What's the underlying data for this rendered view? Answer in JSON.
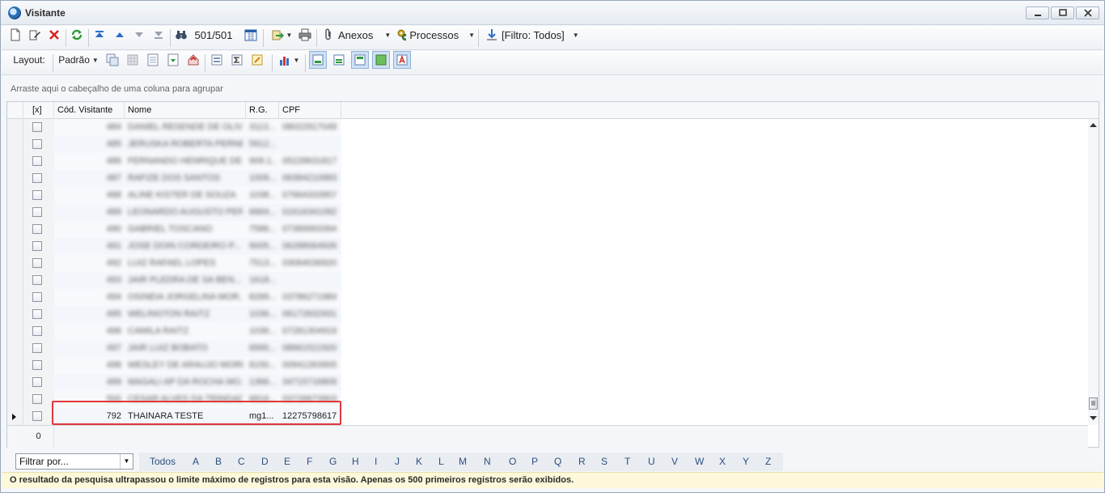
{
  "window": {
    "title": "Visitante"
  },
  "toolbar": {
    "record_counter": "501/501",
    "anexos_label": "Anexos",
    "processos_label": "Processos",
    "filtro_label": "[Filtro: Todos]"
  },
  "layoutbar": {
    "layout_label": "Layout:",
    "padrao_label": "Padrão"
  },
  "groupbar": {
    "hint": "Arraste aqui o cabeçalho de uma coluna para agrupar"
  },
  "grid": {
    "columns": {
      "check": "[x]",
      "codigo": "Cód. Visitante",
      "nome": "Nome",
      "rg": "R.G.",
      "cpf": "CPF"
    },
    "rows": [
      {
        "codigo": "484",
        "nome": "DANIEL RESENDE DE OLIV...",
        "rg": "3113...",
        "cpf": "08022917049"
      },
      {
        "codigo": "485",
        "nome": "JERUSKA ROBERTA PERNE...",
        "rg": "5912...",
        "cpf": ""
      },
      {
        "codigo": "486",
        "nome": "FERNANDO HENRIQUE DE ...",
        "rg": "909.1...",
        "cpf": "05228631817"
      },
      {
        "codigo": "487",
        "nome": "RAFIZE DOS SANTOS",
        "rg": "1009...",
        "cpf": "06384210983"
      },
      {
        "codigo": "488",
        "nome": "ALINE KISTER DE SOUZA",
        "rg": "1038...",
        "cpf": "07664333957"
      },
      {
        "codigo": "489",
        "nome": "LEONARDO AUGUSTO PER...",
        "rg": "6664...",
        "cpf": "01616341092"
      },
      {
        "codigo": "490",
        "nome": "GABRIEL TOSCANO",
        "rg": "7586...",
        "cpf": "07389993394"
      },
      {
        "codigo": "491",
        "nome": "JOSE DOIN CORDEIRO P...",
        "rg": "9005...",
        "cpf": "06288064939"
      },
      {
        "codigo": "492",
        "nome": "LUIZ RAFAEL LOPES",
        "rg": "7513...",
        "cpf": "03064036920"
      },
      {
        "codigo": "493",
        "nome": "JAIR PLEDRA DE SA BEN...",
        "rg": "1618...",
        "cpf": ""
      },
      {
        "codigo": "494",
        "nome": "OSINEIA JORGELINA MOR...",
        "rg": "8289...",
        "cpf": "03786271984"
      },
      {
        "codigo": "495",
        "nome": "WELINGTON RAITZ",
        "rg": "1036...",
        "cpf": "06172832931"
      },
      {
        "codigo": "496",
        "nome": "CAMILA RAITZ",
        "rg": "1036...",
        "cpf": "07281304919"
      },
      {
        "codigo": "497",
        "nome": "JAIR LUIZ BOBATO",
        "rg": "6990...",
        "cpf": "08661521920"
      },
      {
        "codigo": "498",
        "nome": "WESLEY DE ARAUJO MORE...",
        "rg": "8150...",
        "cpf": "00941263905"
      },
      {
        "codigo": "499",
        "nome": "MAGALI AP DA ROCHA MO...",
        "rg": "1366...",
        "cpf": "34715716809"
      },
      {
        "codigo": "500",
        "nome": "CESAR ALVES DA TRINDADE",
        "rg": "6816...",
        "cpf": "03726673903"
      },
      {
        "codigo": "792",
        "nome": "THAINARA TESTE",
        "rg": "mg1...",
        "cpf": "12275798617"
      }
    ],
    "footer_count": "0"
  },
  "alphabar": {
    "filter_placeholder": "Filtrar por...",
    "letters": [
      "Todos",
      "A",
      "B",
      "C",
      "D",
      "E",
      "F",
      "G",
      "H",
      "I",
      "J",
      "K",
      "L",
      "M",
      "N",
      "O",
      "P",
      "Q",
      "R",
      "S",
      "T",
      "U",
      "V",
      "W",
      "X",
      "Y",
      "Z"
    ]
  },
  "status": {
    "message": "O resultado da pesquisa ultrapassou o limite máximo de registros para esta visão. Apenas os 500 primeiros registros serão exibidos."
  },
  "colors": {
    "highlight": "#e2373b",
    "status_bg": "#fdf8d9",
    "letters": "#2d4f7d"
  }
}
